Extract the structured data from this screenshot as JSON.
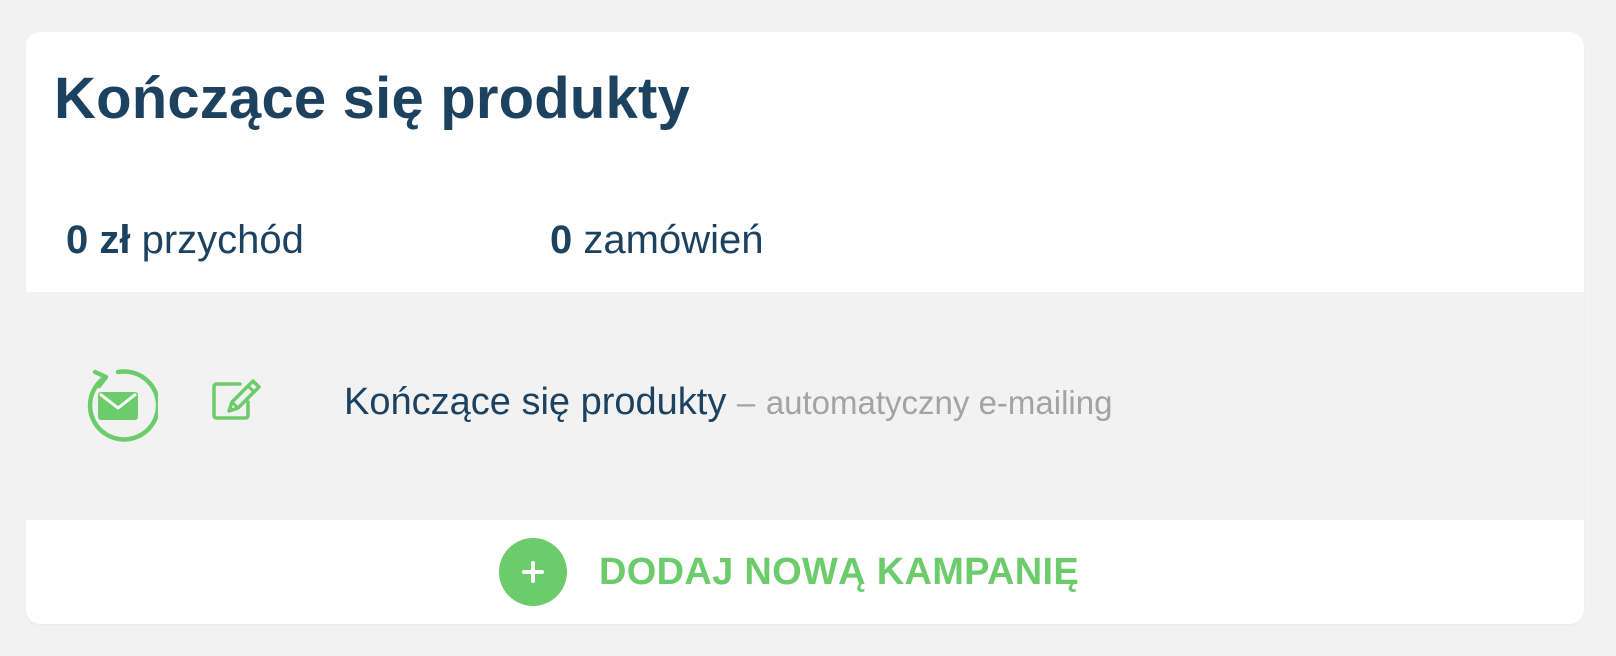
{
  "card": {
    "title": "Kończące się produkty"
  },
  "stats": {
    "revenue": {
      "value": "0 zł",
      "label": "przychód"
    },
    "orders": {
      "value": "0",
      "label": "zamówień"
    }
  },
  "campaign": {
    "name": "Kończące się produkty",
    "separator": "–",
    "type": "automatyczny e-mailing",
    "status_icon": "automatic-email-icon",
    "edit_icon": "edit-icon"
  },
  "actions": {
    "add_campaign_label": "DODAJ NOWĄ KAMPANIĘ",
    "add_icon": "plus-icon"
  },
  "colors": {
    "title": "#1c4260",
    "accent": "#6ccc6c",
    "muted_text": "#a3a3a3",
    "row_background": "#f2f2f2"
  }
}
